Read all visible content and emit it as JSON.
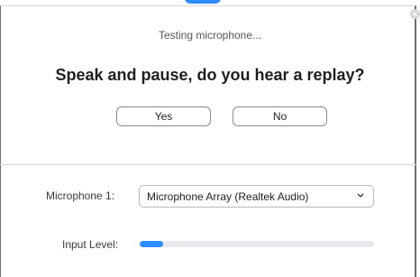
{
  "dialog": {
    "status_text": "Testing microphone...",
    "question": "Speak and pause, do you hear a replay?",
    "buttons": {
      "yes_label": "Yes",
      "no_label": "No"
    }
  },
  "microphone": {
    "label": "Microphone 1:",
    "selected_device": "Microphone Array (Realtek Audio)"
  },
  "input_level": {
    "label": "Input Level:",
    "level_fraction": 0.1
  },
  "colors": {
    "accent": "#2d8cff",
    "track": "#e6e8ec"
  },
  "icons": {
    "close": "close-icon",
    "dropdown": "chevron-down-icon"
  }
}
